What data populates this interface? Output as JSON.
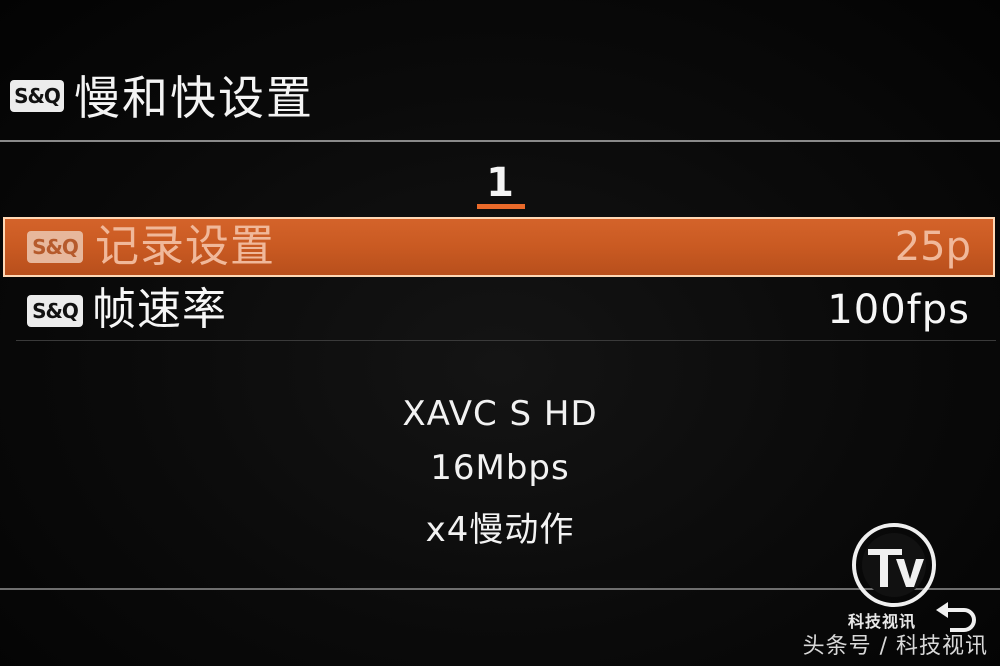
{
  "header": {
    "badge": "S&Q",
    "title": "慢和快设置"
  },
  "page": {
    "number": "1"
  },
  "menu": {
    "items": [
      {
        "badge": "S&Q",
        "label": "记录设置",
        "value": "25p",
        "selected": true
      },
      {
        "badge": "S&Q",
        "label": "帧速率",
        "value": "100fps",
        "selected": false
      }
    ]
  },
  "info": {
    "format": "XAVC S HD",
    "bitrate": "16Mbps",
    "slow_motion": "x4慢动作"
  },
  "watermark": {
    "logo_text": "科技视讯",
    "footer": "头条号 / 科技视讯"
  },
  "icons": {
    "back": "back-arrow-icon",
    "logo": "tv-logo-icon"
  },
  "colors": {
    "accent": "#d4632a",
    "background": "#050505"
  }
}
